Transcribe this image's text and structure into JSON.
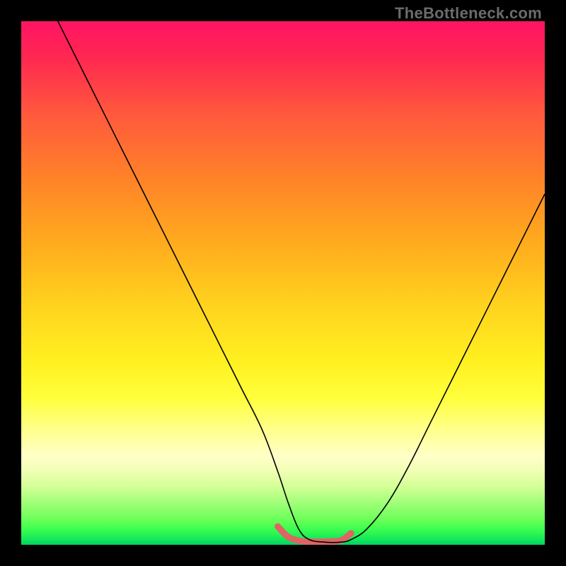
{
  "attribution": "TheBottleneck.com",
  "chart_data": {
    "type": "line",
    "title": "",
    "xlabel": "",
    "ylabel": "",
    "xlim": [
      0,
      100
    ],
    "ylim": [
      0,
      100
    ],
    "grid": false,
    "legend": false,
    "annotations": [],
    "series": [
      {
        "name": "main-curve",
        "stroke": "#000000",
        "stroke_width": 1.6,
        "x": [
          7,
          10,
          14,
          18,
          22,
          26,
          30,
          34,
          38,
          42,
          46,
          49,
          51,
          53,
          55,
          58,
          61,
          63,
          66,
          70,
          74,
          78,
          82,
          86,
          90,
          94,
          98,
          100
        ],
        "y": [
          100,
          94,
          86,
          78,
          70,
          62,
          54,
          46,
          38,
          30,
          22,
          14,
          8,
          3,
          1,
          0.5,
          0.5,
          1,
          3,
          8,
          15,
          23,
          31,
          39,
          47,
          55,
          63,
          67
        ]
      },
      {
        "name": "bottom-highlight",
        "stroke": "#e06464",
        "stroke_width": 9,
        "linecap": "round",
        "x": [
          49,
          51,
          53,
          55,
          58,
          61,
          63
        ],
        "y": [
          3.5,
          1.5,
          0.8,
          0.6,
          0.6,
          0.8,
          2.2
        ]
      }
    ]
  }
}
